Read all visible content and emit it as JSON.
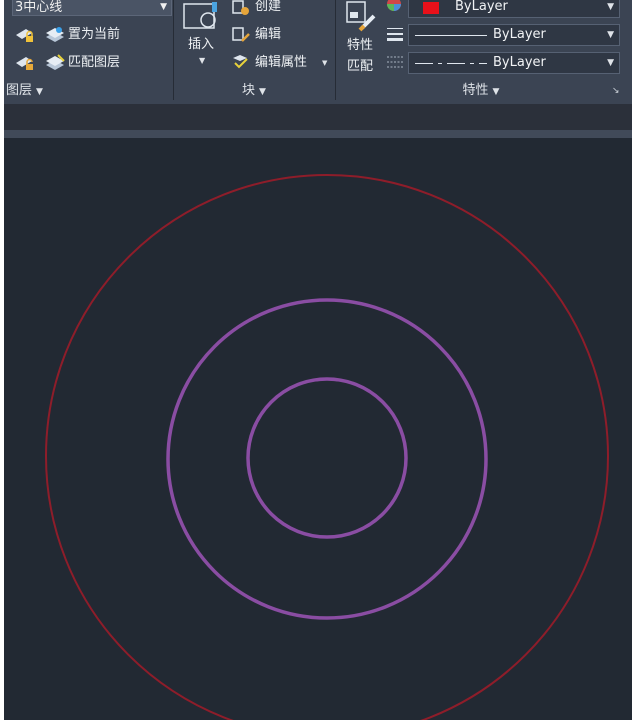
{
  "layers_panel": {
    "current_layer": "3中心线",
    "set_current_label": "置为当前",
    "match_layer_label": "匹配图层",
    "title": "图层"
  },
  "block_panel": {
    "insert_label": "插入",
    "create_label": "创建",
    "edit_label": "编辑",
    "edit_attributes_label": "编辑属性",
    "title": "块"
  },
  "properties_panel": {
    "match_properties_label_1": "特性",
    "match_properties_label_2": "匹配",
    "color_value": "ByLayer",
    "color_swatch": "#e8101a",
    "lineweight_value": "ByLayer",
    "linetype_value": "ByLayer",
    "title": "特性"
  },
  "drawing": {
    "background": "#222933",
    "outer_circle_color": "#8e1d2a",
    "inner_circle_color": "#8a4da3"
  }
}
